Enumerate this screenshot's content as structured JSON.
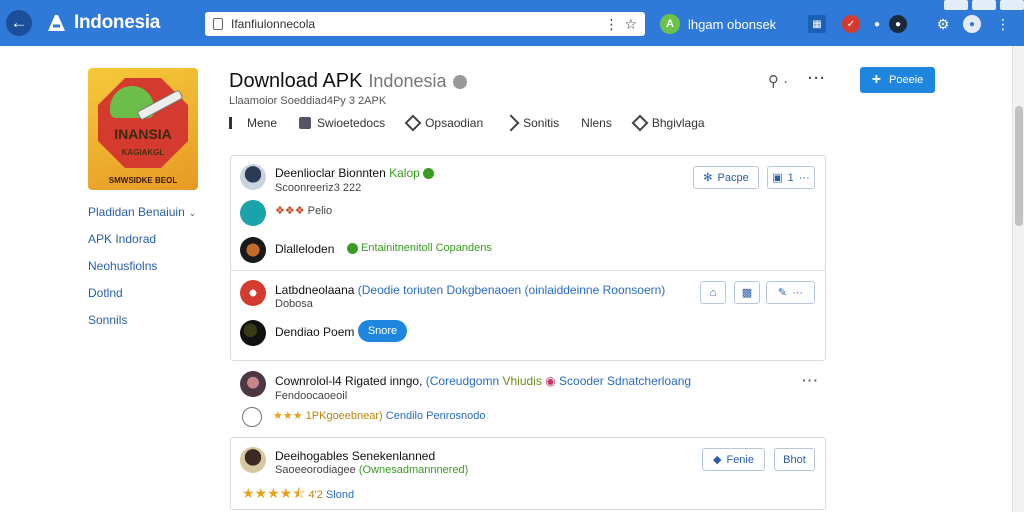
{
  "browser": {
    "brand": "Indonesia",
    "url": "Ifanfiulonnecola",
    "account_label": "lhgam obonsek"
  },
  "sidebar": {
    "app_icon": {
      "title": "INANSIA",
      "subtitle": "KAGIAKGL",
      "footer": "SMWSIDKE BEOL"
    },
    "items": [
      {
        "label": "Pladidan Benaiuin",
        "has_chevron": true
      },
      {
        "label": "APK Indorad"
      },
      {
        "label": "Neohusfiolns"
      },
      {
        "label": "Dotlnd"
      },
      {
        "label": "Sonnils"
      }
    ]
  },
  "header": {
    "title": "Download APK",
    "title_suffix": "Indonesia",
    "subtitle": "Llaamoior Soeddiad4Py 3 2APK",
    "primary_button": "Poeeie"
  },
  "tabs": [
    {
      "label": "Mene",
      "icon": "list-icon"
    },
    {
      "label": "Swioetedocs",
      "icon": "puzzle-icon"
    },
    {
      "label": "Opsaodian",
      "icon": "tag-icon"
    },
    {
      "label": "Sonitis",
      "icon": "share-icon"
    },
    {
      "label": "Nlens",
      "icon": "none"
    },
    {
      "label": "Bhgivlaga",
      "icon": "tag-icon"
    }
  ],
  "card1": {
    "row1": {
      "name": "Deenlioclar Bionnten",
      "tag": "Kalop",
      "meta": "Scoonreeriz3 222",
      "follow_label": "Pacpe",
      "count_label": "1"
    },
    "row2": {
      "rating_text": "Pelio"
    },
    "row3": {
      "name": "Dlalleloden",
      "badge": "Entainitnenitoll Copandens"
    }
  },
  "card2": {
    "row1": {
      "name": "Latbdneolaana",
      "link": "(Deodie toriuten Dokgbenaoen (oinlaiddeinne Roonsoern)",
      "meta": "Dobosa"
    },
    "row2": {
      "name": "Dendiao Poem",
      "pill": "Snore"
    }
  },
  "item3": {
    "name": "Cownrolol-l4 Rigated inngo,",
    "link1": "(Coreudgomn",
    "link2": "Vhiudis",
    "link3": "Scooder Sdnatcherloang",
    "meta": "Fendoocaoeoil",
    "stars_label": "1PKgoeebnear)",
    "stars_link": "Cendilo Penrosnodo",
    "rating": 3
  },
  "card4": {
    "name": "Deeihogables Senekenlanned",
    "meta": "Saoeeorodiagee",
    "meta_link": "(Ownesadmannnered)",
    "rating": 4.5,
    "count": "4'2",
    "count_label": "Slond",
    "btn1": "Fenie",
    "btn2": "Bhot"
  },
  "colors": {
    "topbar": "#2f7ad8",
    "accent": "#1f86e0",
    "green": "#3a9b21",
    "link": "#2a6cc0",
    "star": "#e8a21a"
  }
}
